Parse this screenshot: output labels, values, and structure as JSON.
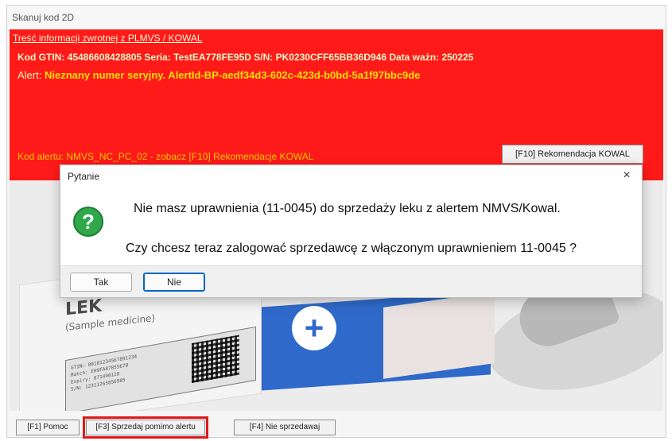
{
  "window": {
    "title": "Skanuj kod 2D"
  },
  "alert_panel": {
    "header": "Treść informacji zwrotnej z PLMVS / KOWAL",
    "info_line": "Kod GTIN: 45486608428805   Seria: TestEA778FE95D   S/N: PK0230CFF65BB36D946   Data ważn: 250225",
    "alert_label": "Alert:",
    "alert_text": "Nieznany numer seryjny. AlertId-BP-aedf34d3-602c-423d-b0bd-5a1f97bbc9de",
    "code_line": "Kod alertu: NMVS_NC_PC_02 - zobacz [F10] Rekomendacje KOWAL",
    "recommendation_button": "[F10] Rekomendacja KOWAL",
    "bg_color": "#ff1a1a",
    "alert_color": "#ffe000"
  },
  "illustration": {
    "product_name": "LEK",
    "product_subtitle": "(Sample medicine)",
    "label_lines": [
      "GTIN:   00101234567891234",
      "Batch:  EH9FA8785567B",
      "Expiry: 071490128",
      "S/N:    12311265856985"
    ],
    "plus_symbol": "+"
  },
  "dialog": {
    "title": "Pytanie",
    "close": "×",
    "icon": "question-icon",
    "icon_glyph": "?",
    "message_line1": "Nie masz uprawnienia (11-0045) do sprzedaży leku z alertem NMVS/Kowal.",
    "message_line2": "Czy chcesz teraz zalogować sprzedawcę z włączonym uprawnieniem 11-0045 ?",
    "yes_button": "Tak",
    "no_button": "Nie"
  },
  "bottom_bar": {
    "help": "[F1] Pomoc",
    "sell_anyway": "[F3] Sprzedaj pomimo alertu",
    "dont_sell": "[F4] Nie sprzedawaj",
    "highlight_color": "#e01818"
  }
}
